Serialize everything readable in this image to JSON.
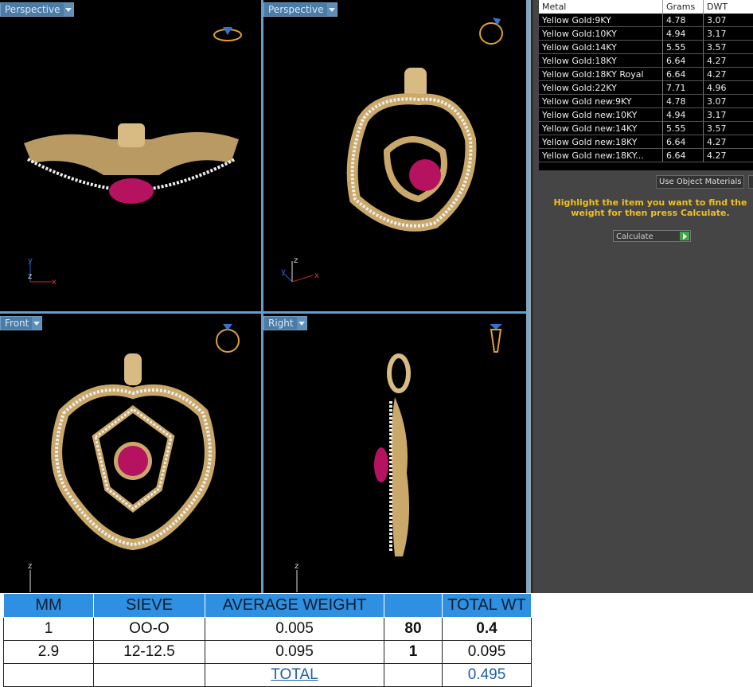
{
  "viewports": [
    {
      "label": "Perspective",
      "icon": "ring-top-icon"
    },
    {
      "label": "Perspective",
      "icon": "ring-angle-icon"
    },
    {
      "label": "Front",
      "icon": "ring-front-icon"
    },
    {
      "label": "Right",
      "icon": "ring-side-icon"
    }
  ],
  "axes": {
    "v1": [
      "y",
      "z",
      "x"
    ],
    "v2": [
      "z",
      "y",
      "x"
    ],
    "v3": [
      "z"
    ],
    "v4": [
      "z"
    ]
  },
  "metal_table": {
    "headers": [
      "Metal",
      "Grams",
      "DWT"
    ],
    "rows": [
      [
        "Yellow Gold:9KY",
        "4.78",
        "3.07"
      ],
      [
        "Yellow Gold:10KY",
        "4.94",
        "3.17"
      ],
      [
        "Yellow Gold:14KY",
        "5.55",
        "3.57"
      ],
      [
        "Yellow Gold:18KY",
        "6.64",
        "4.27"
      ],
      [
        "Yellow Gold:18KY Royal",
        "6.64",
        "4.27"
      ],
      [
        "Yellow Gold:22KY",
        "7.71",
        "4.96"
      ],
      [
        "Yellow Gold new:9KY",
        "4.78",
        "3.07"
      ],
      [
        "Yellow Gold new:10KY",
        "4.94",
        "3.17"
      ],
      [
        "Yellow Gold new:14KY",
        "5.55",
        "3.57"
      ],
      [
        "Yellow Gold new:18KY",
        "6.64",
        "4.27"
      ],
      [
        "Yellow Gold new:18KY...",
        "6.64",
        "4.27"
      ]
    ]
  },
  "panel": {
    "use_object_materials": "Use Object Materials",
    "hint": "Highlight the item you want to find the weight for then press Calculate.",
    "calculate": "Calculate"
  },
  "sieve_table": {
    "headers": [
      "MM",
      "SIEVE",
      "AVERAGE WEIGHT",
      "",
      "TOTAL WT"
    ],
    "rows": [
      [
        "1",
        "OO-O",
        "0.005",
        "80",
        "0.4"
      ],
      [
        "2.9",
        "12-12.5",
        "0.095",
        "1",
        "0.095"
      ]
    ],
    "total_label": "TOTAL",
    "total_value": "0.495"
  },
  "colors": {
    "gold": "#c9a86a",
    "ruby": "#c0186a",
    "accent": "#2f8fe0"
  }
}
